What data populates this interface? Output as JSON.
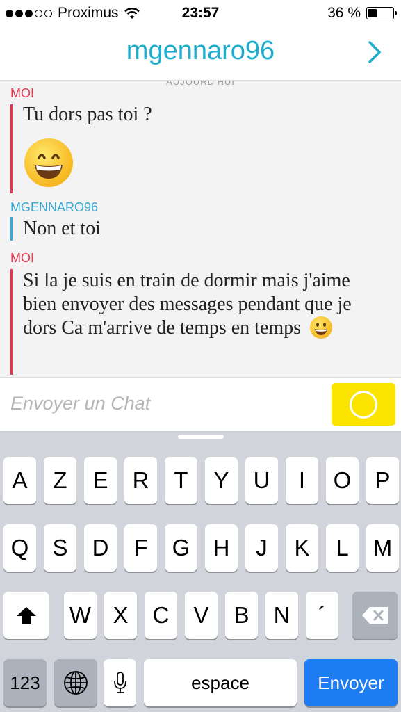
{
  "status": {
    "carrier": "Proximus",
    "time": "23:57",
    "battery": "36 %",
    "battery_level": 0.36,
    "signal_bars": 3,
    "signal_total": 5
  },
  "header": {
    "title": "mgennaro96"
  },
  "chat": {
    "day_label": "AUJOURD'HUI",
    "messages": [
      {
        "sender": "MOI",
        "text": "Tu dors pas toi ?"
      },
      {
        "sender": "MGENNARO96",
        "text": "Non et toi"
      },
      {
        "sender": "MOI",
        "text": "Si la je suis en train de dormir mais j'aime bien envoyer des messages pendant que je dors Ca m'arrive de temps en temps"
      }
    ]
  },
  "input": {
    "placeholder": "Envoyer un Chat"
  },
  "keyboard": {
    "row1": [
      "A",
      "Z",
      "E",
      "R",
      "T",
      "Y",
      "U",
      "I",
      "O",
      "P"
    ],
    "row2": [
      "Q",
      "S",
      "D",
      "F",
      "G",
      "H",
      "J",
      "K",
      "L",
      "M"
    ],
    "row3": [
      "W",
      "X",
      "C",
      "V",
      "B",
      "N",
      "´"
    ],
    "numbers": "123",
    "space": "espace",
    "send": "Envoyer"
  },
  "colors": {
    "accent": "#1eaecb",
    "me": "#e8344e",
    "them": "#36a9d8",
    "send_button": "#fae400",
    "keyboard_send": "#1d7cf2"
  }
}
